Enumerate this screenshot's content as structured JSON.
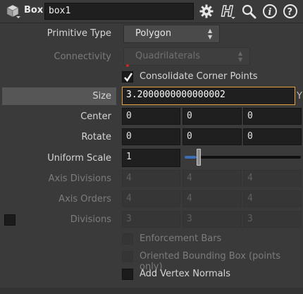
{
  "header": {
    "node_type": "Box",
    "node_name": "box1",
    "icons": [
      "box-icon",
      "gear-icon",
      "help-h-icon",
      "search-icon",
      "info-icon",
      "question-icon"
    ]
  },
  "params": {
    "primitive_type": {
      "label": "Primitive Type",
      "value": "Polygon"
    },
    "connectivity": {
      "label": "Connectivity",
      "value": "Quadrilaterals"
    },
    "consolidate": {
      "label": "Consolidate Corner Points",
      "checked": true
    },
    "size": {
      "label": "Size",
      "value": "3.2000000000000002",
      "suffix": "Y"
    },
    "center": {
      "label": "Center",
      "x": "0",
      "y": "0",
      "z": "0"
    },
    "rotate": {
      "label": "Rotate",
      "x": "0",
      "y": "0",
      "z": "0"
    },
    "uniform_scale": {
      "label": "Uniform Scale",
      "value": "1",
      "slider_fraction": 0.1
    },
    "axis_divisions": {
      "label": "Axis Divisions",
      "x": "4",
      "y": "4",
      "z": "4"
    },
    "axis_orders": {
      "label": "Axis Orders",
      "x": "4",
      "y": "4",
      "z": "4"
    },
    "divisions": {
      "label": "Divisions",
      "x": "3",
      "y": "3",
      "z": "3"
    },
    "enforcement_bars": {
      "label": "Enforcement Bars",
      "checked": false
    },
    "oriented_bbox": {
      "label": "Oriented Bounding Box (points only)",
      "checked": false
    },
    "vertex_normals": {
      "label": "Add Vertex Normals",
      "checked": false
    }
  },
  "colors": {
    "accent": "#e8a03a",
    "background": "#3a3a3a",
    "field": "#1f1f1f"
  }
}
